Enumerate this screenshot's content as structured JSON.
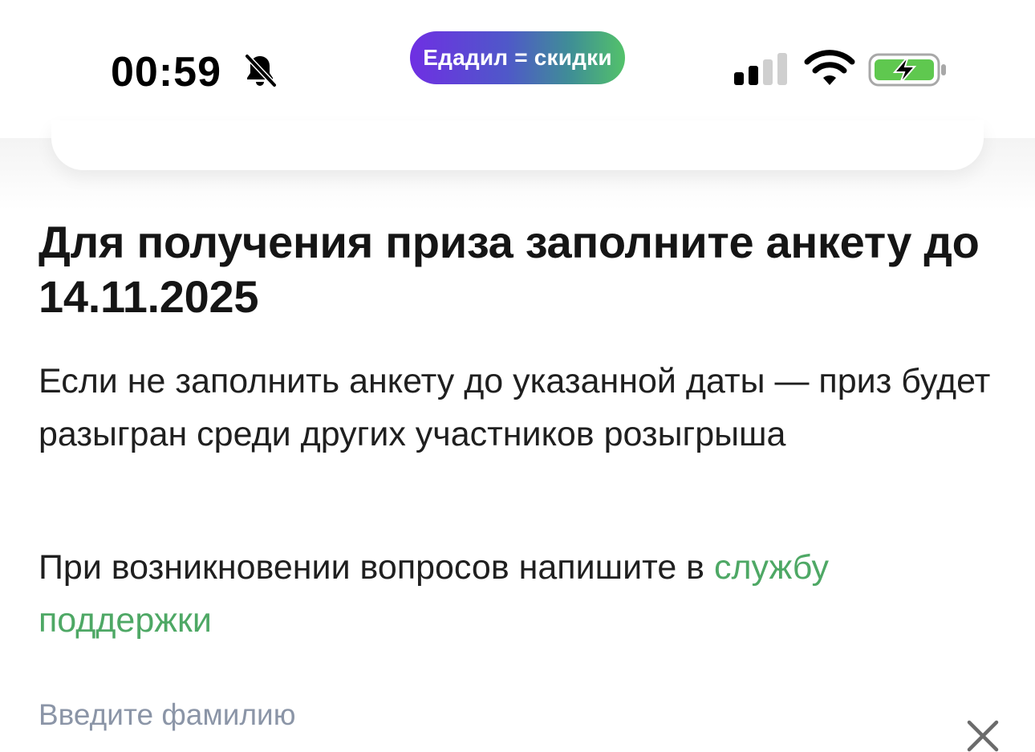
{
  "status_bar": {
    "time": "00:59",
    "promo_label": "Едадил = скидки",
    "icons": [
      "bell-muted-icon",
      "cellular-signal-icon",
      "wifi-icon",
      "battery-charging-icon"
    ],
    "colors": {
      "pill_start": "#6f2fe3",
      "pill_end": "#53c26a",
      "battery_fill": "#5fc84f"
    }
  },
  "content": {
    "headline": "Для получения приза заполните анкету до 14.11.2025",
    "body": "Если не заполнить анкету до указанной даты — приз будет разыгран среди других участников розыгрыша",
    "help_prefix": "При возникновении вопросов напишите в ",
    "help_link": "службу поддержки",
    "link_color": "#4ea865"
  },
  "form": {
    "surname_placeholder": "Введите фамилию",
    "surname_value": "",
    "clear_icon": "close-icon"
  }
}
